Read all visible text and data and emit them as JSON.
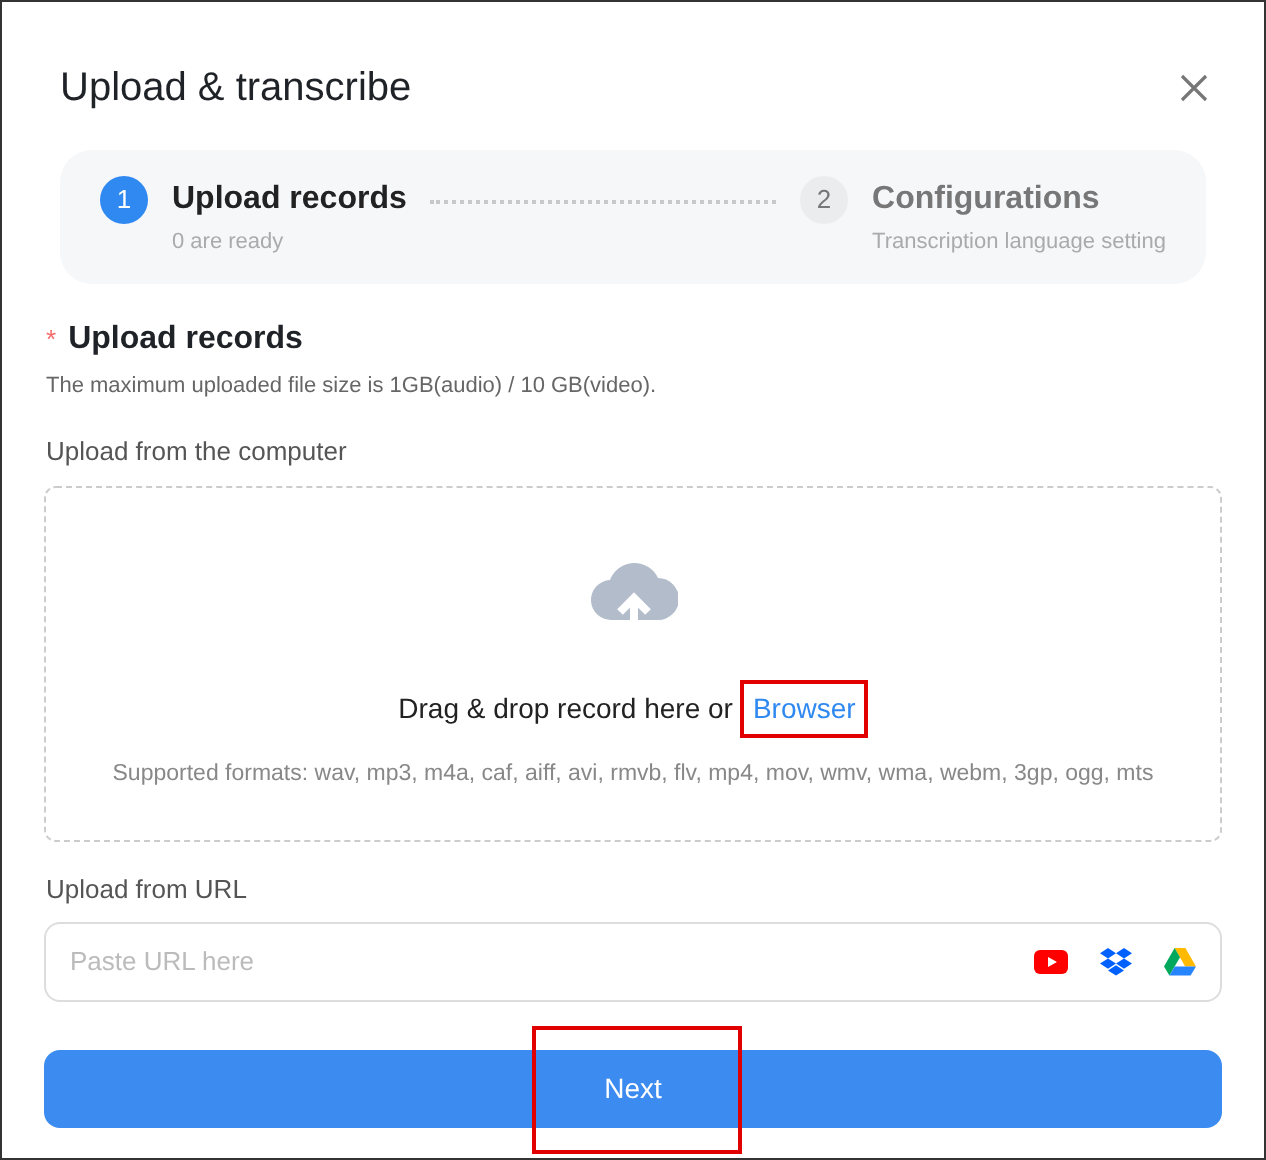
{
  "dialog": {
    "title": "Upload & transcribe"
  },
  "steps": [
    {
      "number": "1",
      "title": "Upload records",
      "subtitle": "0 are ready",
      "selected": true
    },
    {
      "number": "2",
      "title": "Configurations",
      "subtitle": "Transcription language setting",
      "selected": false
    }
  ],
  "section": {
    "required_mark": "*",
    "title": "Upload records",
    "note": "The maximum uploaded file size is 1GB(audio) / 10 GB(video)."
  },
  "computer": {
    "label": "Upload from the computer",
    "prompt": "Drag & drop record here or",
    "link": {
      "text": "Browser",
      "highlighted": true
    },
    "formats": "Supported formats: wav, mp3, m4a, caf, aiff, avi, rmvb, flv, mp4, mov, wmv, wma, webm, 3gp, ogg, mts"
  },
  "url": {
    "label": "Upload from URL",
    "placeholder": "Paste URL here"
  },
  "next_button": {
    "label": "Next",
    "highlighted": true
  }
}
